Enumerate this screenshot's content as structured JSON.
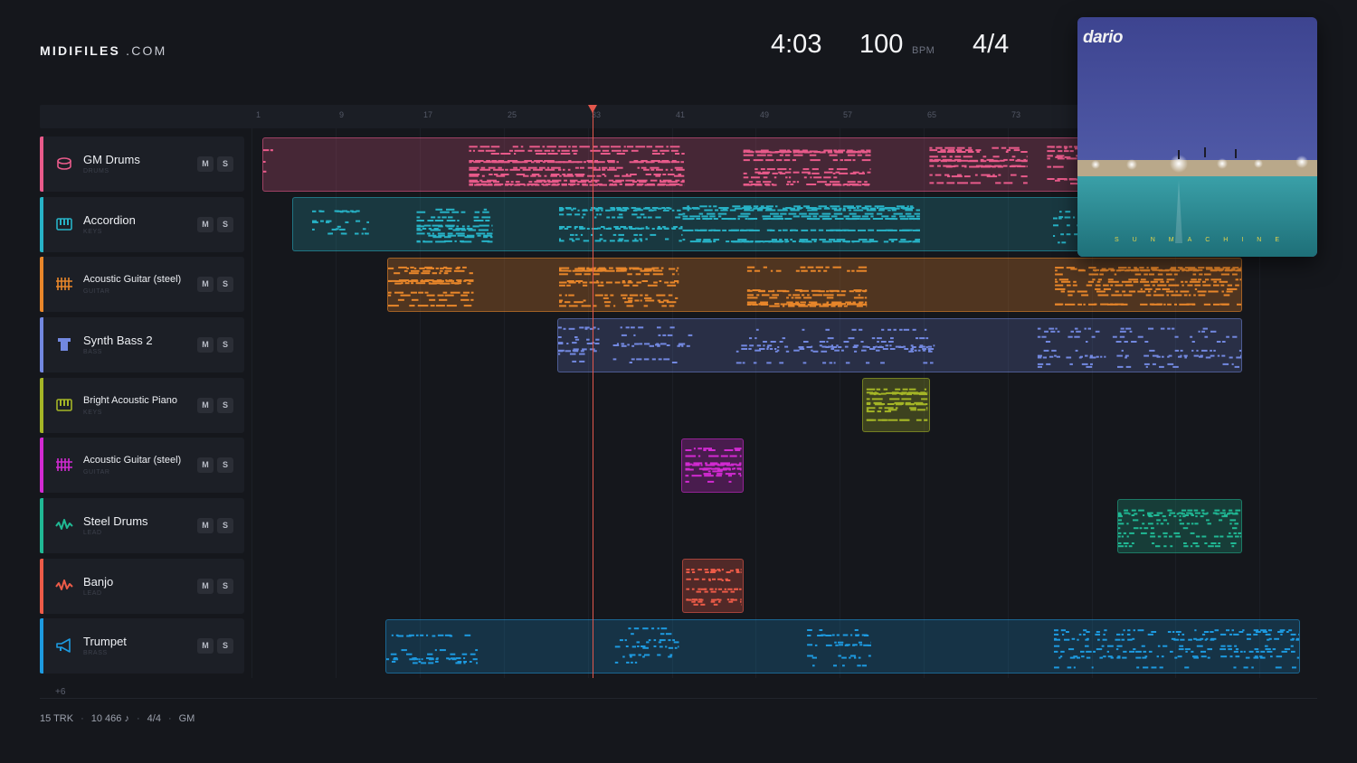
{
  "header": {
    "logo_bold": "MIDIFILES",
    "logo_light": ".COM",
    "time": "4:03",
    "bpm": "100",
    "bpm_unit": "BPM",
    "signature": "4/4"
  },
  "ruler": {
    "ticks": [
      "1",
      "9",
      "17",
      "25",
      "33",
      "41",
      "49",
      "57",
      "65",
      "73"
    ]
  },
  "playhead": {
    "bar": 33
  },
  "tracks": [
    {
      "name": "GM Drums",
      "category": "DRUMS",
      "color": "#e85a8a",
      "icon": "drum-icon"
    },
    {
      "name": "Accordion",
      "category": "KEYS",
      "color": "#27b2c6",
      "icon": "keyboard-icon"
    },
    {
      "name": "Acoustic Guitar (steel)",
      "category": "GUITAR",
      "color": "#e8862a",
      "icon": "guitar-icon"
    },
    {
      "name": "Synth Bass 2",
      "category": "BASS",
      "color": "#7288e0",
      "icon": "bass-icon"
    },
    {
      "name": "Bright Acoustic Piano",
      "category": "KEYS",
      "color": "#a4b526",
      "icon": "keyboard-icon"
    },
    {
      "name": "Acoustic Guitar (steel)",
      "category": "GUITAR",
      "color": "#d22ad2",
      "icon": "guitar-icon"
    },
    {
      "name": "Steel Drums",
      "category": "LEAD",
      "color": "#20b894",
      "icon": "wave-icon"
    },
    {
      "name": "Banjo",
      "category": "LEAD",
      "color": "#ec5b48",
      "icon": "wave-icon"
    },
    {
      "name": "Trumpet",
      "category": "BRASS",
      "color": "#1d9ae0",
      "icon": "horn-icon"
    }
  ],
  "buttons": {
    "mute": "M",
    "solo": "S"
  },
  "more_tracks": "+6",
  "footer": {
    "tracks": "15 TRK",
    "notes": "10 466 ♪",
    "signature": "4/4",
    "standard": "GM",
    "sep": "·"
  },
  "album": {
    "artist": "dario",
    "title": "SUNMACHINE"
  }
}
